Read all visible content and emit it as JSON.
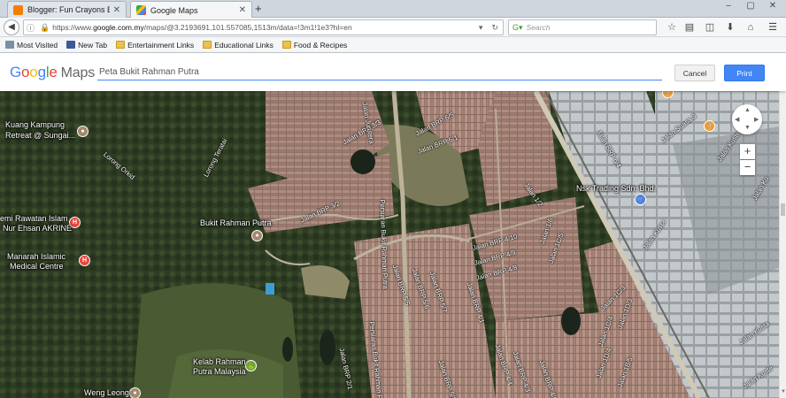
{
  "browser": {
    "tabs": [
      {
        "title": "Blogger: Fun Crayons EduSp",
        "favicon": "blogger-icon"
      },
      {
        "title": "Google Maps",
        "favicon": "google-maps-icon"
      }
    ],
    "url_prefix": "https://www.",
    "url_domain": "google.com.my",
    "url_rest": "/maps/@3.2193691,101.557085,1513m/data=!3m1!1e3?hl=en",
    "search_placeholder": "Search",
    "bookmarks": [
      {
        "label": "Most Visited",
        "icon": "most-visited-icon"
      },
      {
        "label": "New Tab",
        "icon": "facebook-icon"
      },
      {
        "label": "Entertainment Links",
        "icon": "folder-icon"
      },
      {
        "label": "Educational Links",
        "icon": "folder-icon"
      },
      {
        "label": "Food & Recipes",
        "icon": "folder-icon"
      }
    ]
  },
  "maps_header": {
    "logo_google": "Google",
    "logo_maps": "Maps",
    "title_value": "Peta Bukit Rahman Putra",
    "cancel_label": "Cancel",
    "print_label": "Print"
  },
  "map": {
    "places": [
      {
        "name": "Kuang Kampung",
        "type": "retreat"
      },
      {
        "name": "Retreat @ Sungai...",
        "type": "retreat"
      },
      {
        "name": "Bukit Rahman Putra",
        "type": "town"
      },
      {
        "name": "emi Rawatan Islam",
        "type": "hospital"
      },
      {
        "name": "Nur Ehsan AKRINE",
        "type": "hospital"
      },
      {
        "name": "Manarah Islamic",
        "type": "hospital"
      },
      {
        "name": "Medical Centre",
        "type": "hospital"
      },
      {
        "name": "Kelab Rahman",
        "type": "golf"
      },
      {
        "name": "Putra Malaysia",
        "type": "golf"
      },
      {
        "name": "Weng Leong",
        "type": "place"
      },
      {
        "name": "Nsk Trading Sdn. Bhd.",
        "type": "shop"
      }
    ],
    "roads": [
      "Lorong Orkid",
      "Lorong Teratai",
      "Jalan BRP 3/3",
      "Jalan BRP 6/5",
      "Jalan BRP 6/1",
      "Jalan BRP 3/2",
      "Persiaran Bukit Rahman Putra",
      "Persiaran Bukit Rahman Putra",
      "Jalan Jurutera",
      "Jalan 1/2",
      "Jalan BRP 4/10",
      "Jalan BRP 4/9",
      "Jalan BRP 4/8",
      "Jalan BRP 5/5",
      "Jalan BRP 5/6",
      "Jalan BRP 5/7",
      "Jalan BRP 4/1",
      "Jalan BRP 2/1",
      "Jalan BRP 5/2",
      "Jalan BRP 4/4",
      "Jalan BRP 4/3",
      "Jalan BRP 4/5",
      "Jalan 1/6",
      "Jalan 1C/5",
      "Jalan 1C/3",
      "Jalan 1C/4",
      "Jalan 1D/3",
      "Jalan 1B/5",
      "Jalan 1D/4",
      "Jalan BRP 6/4",
      "Jalan Kusta",
      "Jalan Kuste",
      "Jalan Kusta",
      "Jalan Kuste",
      "Jalan Suasa 3",
      "Jalan Ku"
    ]
  }
}
